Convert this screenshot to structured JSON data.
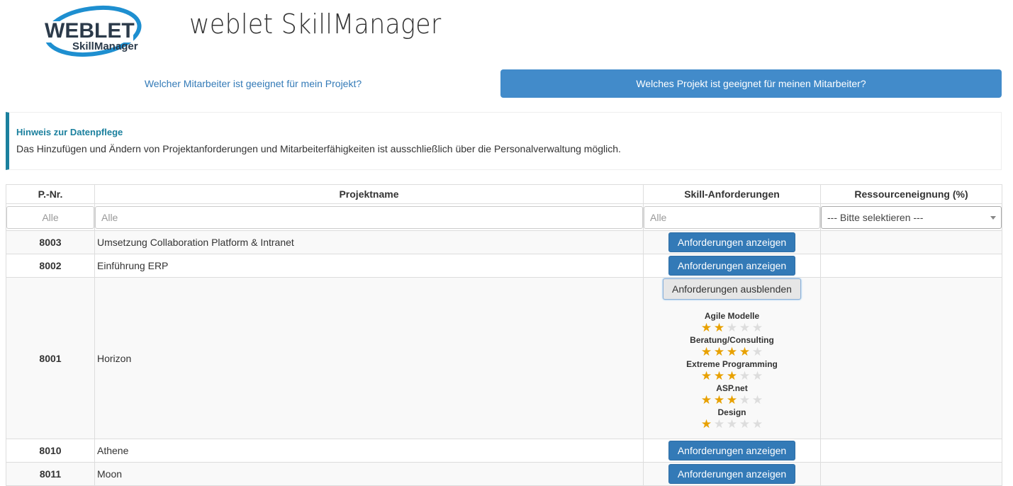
{
  "logo": {
    "line1": "WEBLET",
    "line2": "SkillManager"
  },
  "app_title": "weblet SkillManager",
  "nav": {
    "link1": "Welcher Mitarbeiter ist geeignet für mein Projekt?",
    "link2": "Welches Projekt ist geeignet für meinen Mitarbeiter?"
  },
  "callout": {
    "title": "Hinweis zur Datenpflege",
    "text": "Das Hinzufügen und Ändern von Projektanforderungen und Mitarbeiterfähigkeiten ist ausschließlich über die Personalverwaltung möglich."
  },
  "table": {
    "headers": [
      "P.-Nr.",
      "Projektname",
      "Skill-Anforderungen",
      "Ressourceneignung (%)"
    ],
    "filters": {
      "pnr_placeholder": "Alle",
      "name_placeholder": "Alle",
      "skill_placeholder": "Alle",
      "select_value": "--- Bitte selektieren ---"
    },
    "rows": [
      {
        "pnr": "8003",
        "name": "Umsetzung Collaboration Platform & Intranet",
        "button": "Anforderungen anzeigen"
      },
      {
        "pnr": "8002",
        "name": "Einführung ERP",
        "button": "Anforderungen anzeigen"
      },
      {
        "pnr": "8001",
        "name": "Horizon",
        "button": "Anforderungen ausblenden"
      },
      {
        "pnr": "8010",
        "name": "Athene",
        "button": "Anforderungen anzeigen"
      },
      {
        "pnr": "8011",
        "name": "Moon",
        "button": "Anforderungen anzeigen"
      }
    ],
    "skills": [
      {
        "name": "Agile Modelle",
        "rating": 2,
        "max": 5
      },
      {
        "name": "Beratung/Consulting",
        "rating": 4,
        "max": 5
      },
      {
        "name": "Extreme Programming",
        "rating": 3,
        "max": 5
      },
      {
        "name": "ASP.net",
        "rating": 3,
        "max": 5
      },
      {
        "name": "Design",
        "rating": 1,
        "max": 5
      }
    ]
  },
  "colors": {
    "primary": "#337ab7",
    "nav_active": "#428bca",
    "callout_accent": "#1b809e",
    "star": "#e8a100"
  }
}
